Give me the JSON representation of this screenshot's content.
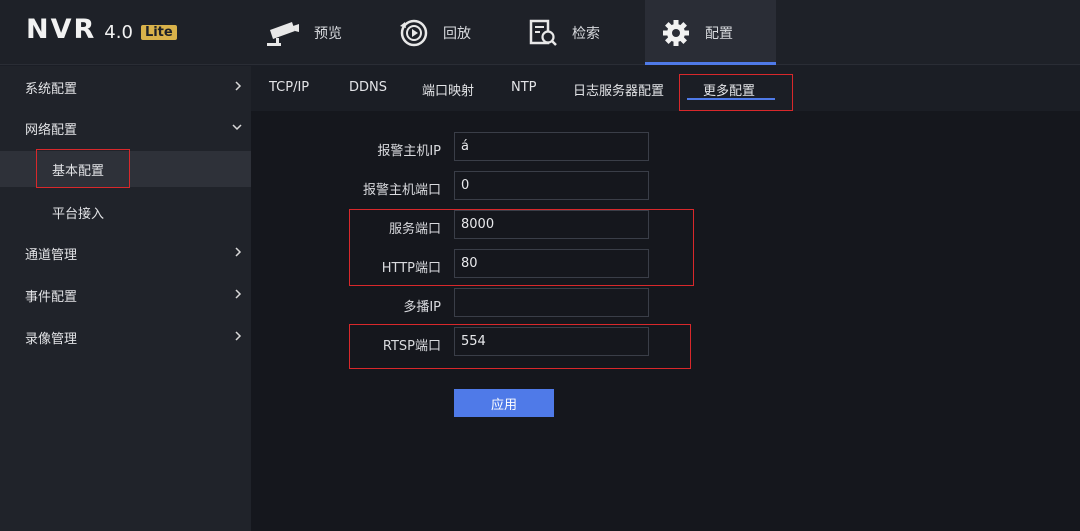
{
  "app": {
    "logo_text": "NVR",
    "version": "4.0",
    "edition": "Lite"
  },
  "topnav": {
    "tabs": [
      {
        "label": "预览",
        "icon": "camera-icon"
      },
      {
        "label": "回放",
        "icon": "playback-icon"
      },
      {
        "label": "检索",
        "icon": "search-document-icon"
      },
      {
        "label": "配置",
        "icon": "gear-icon"
      }
    ],
    "active": "配置"
  },
  "sidebar": {
    "items": [
      {
        "label": "系统配置"
      },
      {
        "label": "网络配置"
      },
      {
        "label": "基本配置"
      },
      {
        "label": "平台接入"
      },
      {
        "label": "通道管理"
      },
      {
        "label": "事件配置"
      },
      {
        "label": "录像管理"
      }
    ],
    "selected": "基本配置"
  },
  "subtabs": {
    "items": [
      "TCP/IP",
      "DDNS",
      "端口映射",
      "NTP",
      "日志服务器配置",
      "更多配置"
    ],
    "active": "更多配置"
  },
  "form": {
    "alarm_host_ip": {
      "label": "报警主机IP",
      "value": "á"
    },
    "alarm_host_port": {
      "label": "报警主机端口",
      "value": "0"
    },
    "service_port": {
      "label": "服务端口",
      "value": "8000"
    },
    "http_port": {
      "label": "HTTP端口",
      "value": "80"
    },
    "multicast_ip": {
      "label": "多播IP",
      "value": ""
    },
    "rtsp_port": {
      "label": "RTSP端口",
      "value": "554"
    },
    "apply_label": "应用"
  },
  "colors": {
    "accent": "#4f7ae8",
    "highlight_box": "#d8282b",
    "background": "#15171d"
  }
}
